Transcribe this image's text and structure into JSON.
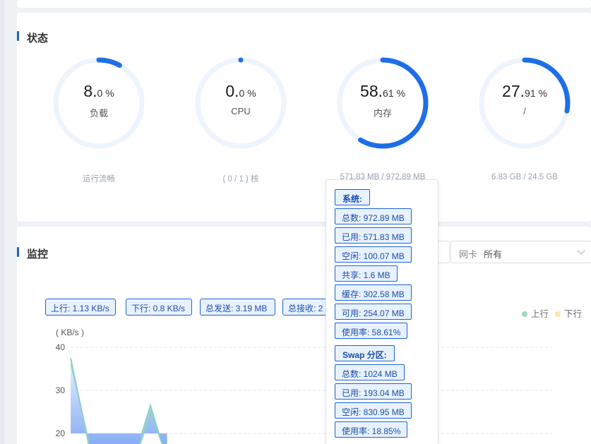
{
  "status": {
    "title": "状态",
    "gauges": [
      {
        "int": "8.",
        "dec": "0 %",
        "label": "负载",
        "foot": "运行流畅",
        "percent": 8.0
      },
      {
        "int": "0.",
        "dec": "0 %",
        "label": "CPU",
        "foot": "( 0 / 1 ) 核",
        "percent": 0.0
      },
      {
        "int": "58.",
        "dec": "61 %",
        "label": "内存",
        "foot": "571.83 MB / 972.89 MB",
        "percent": 58.61
      },
      {
        "int": "27.",
        "dec": "91 %",
        "label": "/",
        "foot": "6.83 GB / 24.5 GB",
        "percent": 27.91
      }
    ]
  },
  "monitor": {
    "title": "监控",
    "nic_label": "网卡",
    "nic_value": "所有",
    "tags": [
      "上行: 1.13 KB/s",
      "下行: 0.8 KB/s",
      "总发送: 3.19 MB",
      "总接收: 2"
    ],
    "legend": [
      {
        "label": "上行",
        "color": "#a3d9b7"
      },
      {
        "label": "下行",
        "color": "#fbe6a6"
      }
    ]
  },
  "tooltip": {
    "system_header": "系统:",
    "system_items": [
      "总数: 972.89 MB",
      "已用: 571.83 MB",
      "空闲: 100.07 MB",
      "共享: 1.6 MB",
      "缓存: 302.58 MB",
      "可用: 254.07 MB",
      "使用率: 58.61%"
    ],
    "swap_header": "Swap 分区:",
    "swap_items": [
      "总数: 1024 MB",
      "已用: 193.04 MB",
      "空闲: 830.95 MB",
      "使用率: 18.85%"
    ]
  },
  "chart_data": {
    "type": "area",
    "ylabel": "( KB/s )",
    "y_ticks": [
      "40",
      "30",
      "20"
    ],
    "ylim": [
      15,
      40
    ],
    "grid": true,
    "series": [
      {
        "name": "上行",
        "values": [
          37.5,
          14,
          14,
          26.5,
          14
        ]
      },
      {
        "name": "下行",
        "values": [
          36,
          14,
          14,
          25,
          14
        ]
      }
    ],
    "colors": {
      "line": "#8fd0c6",
      "fill_top": "#e3ecfd",
      "fill_bottom": "#6d9cf2"
    }
  }
}
